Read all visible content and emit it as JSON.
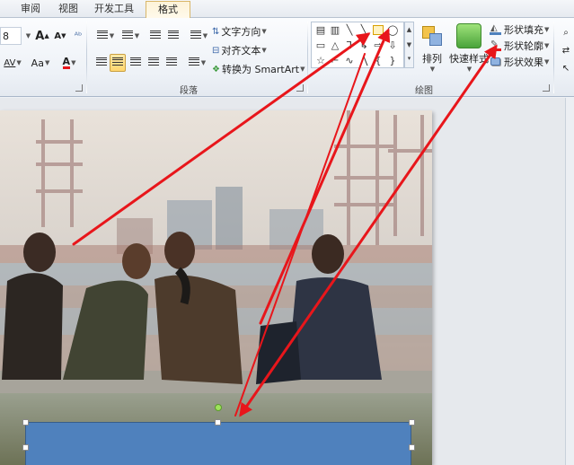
{
  "tabs": {
    "review": "审阅",
    "view": "视图",
    "developer": "开发工具",
    "format": "格式"
  },
  "font_group": {
    "font_size": "8",
    "grow_label": "A",
    "shrink_label": "A",
    "change_case_label": "Aa",
    "font_color_label": "A",
    "char_spacing_label": "AV"
  },
  "paragraph_group": {
    "label": "段落",
    "text_direction": "文字方向",
    "align_text": "对齐文本",
    "convert_smartart": "转换为 SmartArt"
  },
  "drawing_group": {
    "label": "绘图",
    "arrange": "排列",
    "quick_styles": "快速样式",
    "shape_fill": "形状填充",
    "shape_outline": "形状轮廓",
    "shape_effects": "形状效果"
  },
  "icons": {
    "shape_fill": "paint-bucket-icon",
    "shape_outline": "pencil-icon",
    "shape_effects": "shape-effects-icon",
    "arrange": "arrange-icon",
    "quick_styles": "quick-styles-icon"
  },
  "colors": {
    "selected_shape_fill": "#4f81bd",
    "annotation_arrow": "#e8161b",
    "format_tab_accent": "#d9b76a"
  }
}
